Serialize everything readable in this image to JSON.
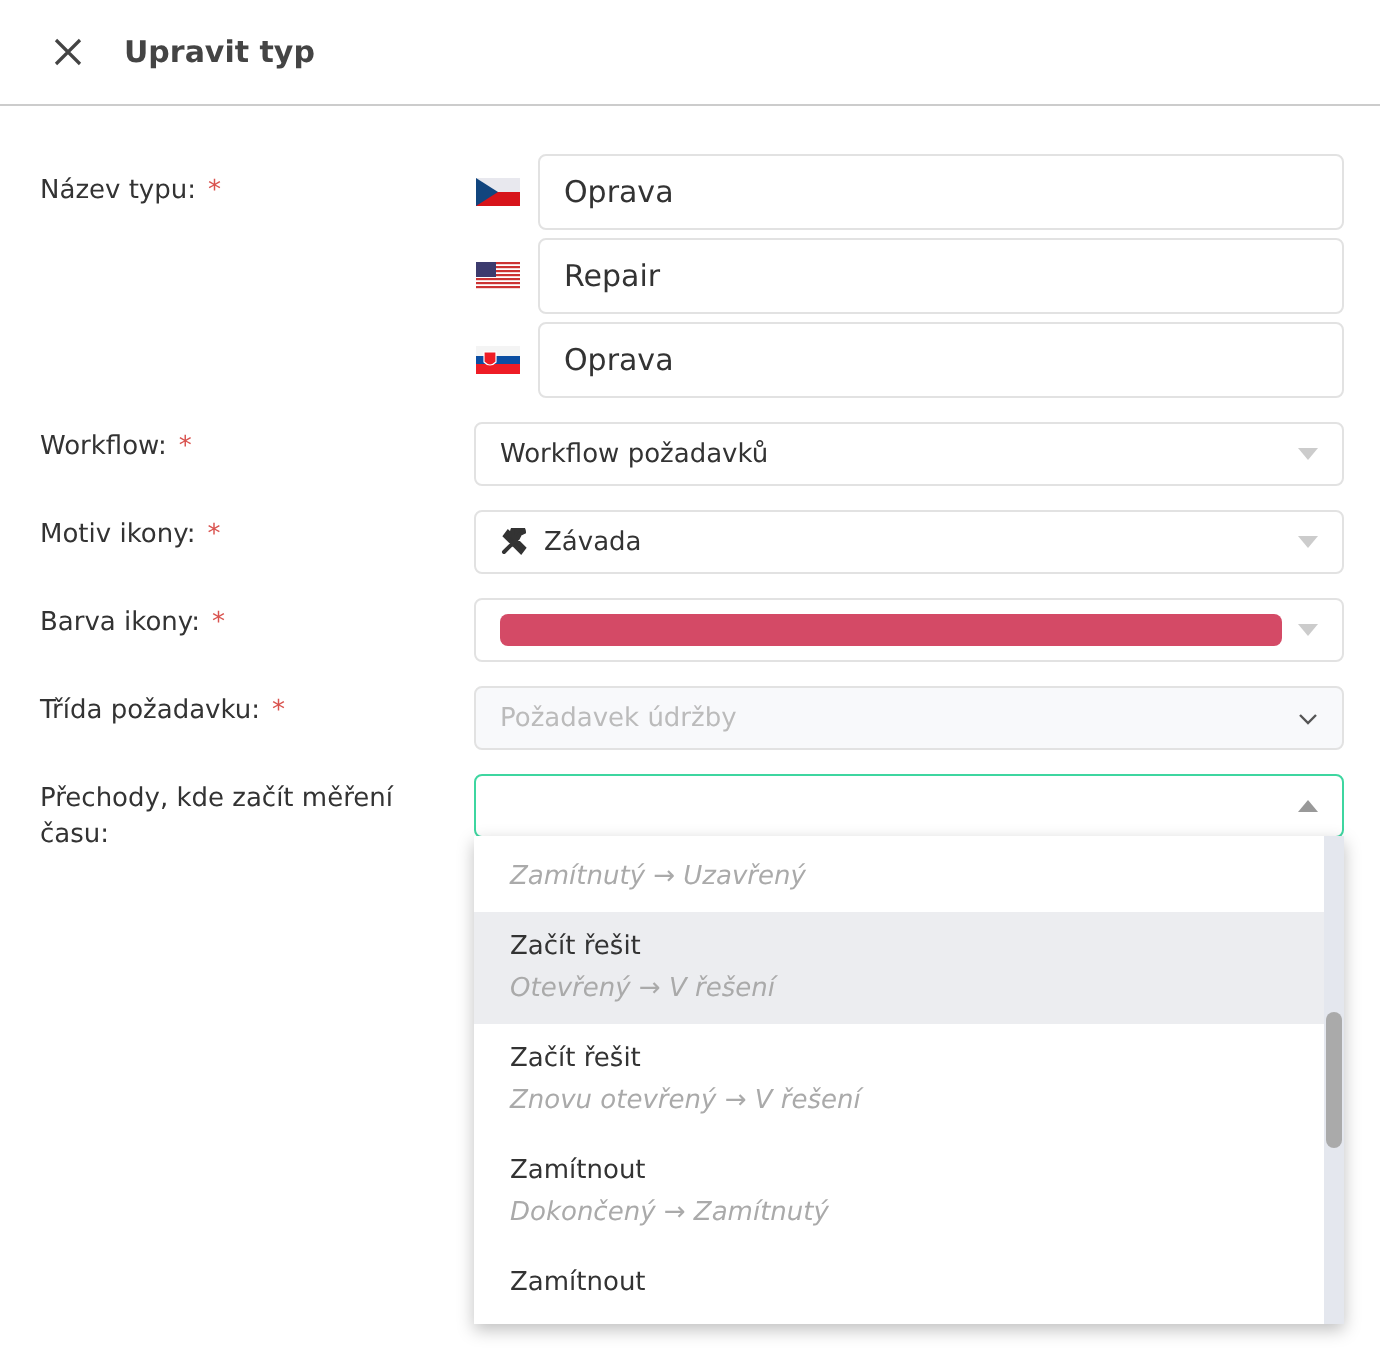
{
  "header": {
    "title": "Upravit typ"
  },
  "form": {
    "name": {
      "label": "Název typu:",
      "required_mark": "*",
      "translations": [
        {
          "value": "Oprava"
        },
        {
          "value": "Repair"
        },
        {
          "value": "Oprava"
        }
      ]
    },
    "fields": [
      {
        "kind": "select",
        "label": "Workflow:",
        "required_mark": "*",
        "value": "Workflow požadavků",
        "disabled": false
      },
      {
        "kind": "icon-select",
        "label": "Motiv ikony:",
        "required_mark": "*",
        "value": "Závada",
        "disabled": false
      },
      {
        "kind": "color-select",
        "label": "Barva ikony:",
        "required_mark": "*",
        "color": "#d44a66",
        "disabled": false
      },
      {
        "kind": "select",
        "label": "Třída požadavku:",
        "required_mark": "*",
        "placeholder": "Požadavek údržby",
        "disabled": true
      },
      {
        "kind": "multiselect",
        "label": "Přechody, kde začít měření času:",
        "expanded": true
      }
    ]
  },
  "dropdown": {
    "options": [
      {
        "subtitle": "Zamítnutý → Uzavřený",
        "selected": false
      },
      {
        "title": "Začít řešit",
        "subtitle": "Otevřený → V řešení",
        "selected": true
      },
      {
        "title": "Začít řešit",
        "subtitle": "Znovu otevřený → V řešení",
        "selected": false
      },
      {
        "title": "Zamítnout",
        "subtitle": "Dokončený → Zamítnutý",
        "selected": false
      },
      {
        "title": "Zamítnout",
        "selected": false
      }
    ]
  }
}
